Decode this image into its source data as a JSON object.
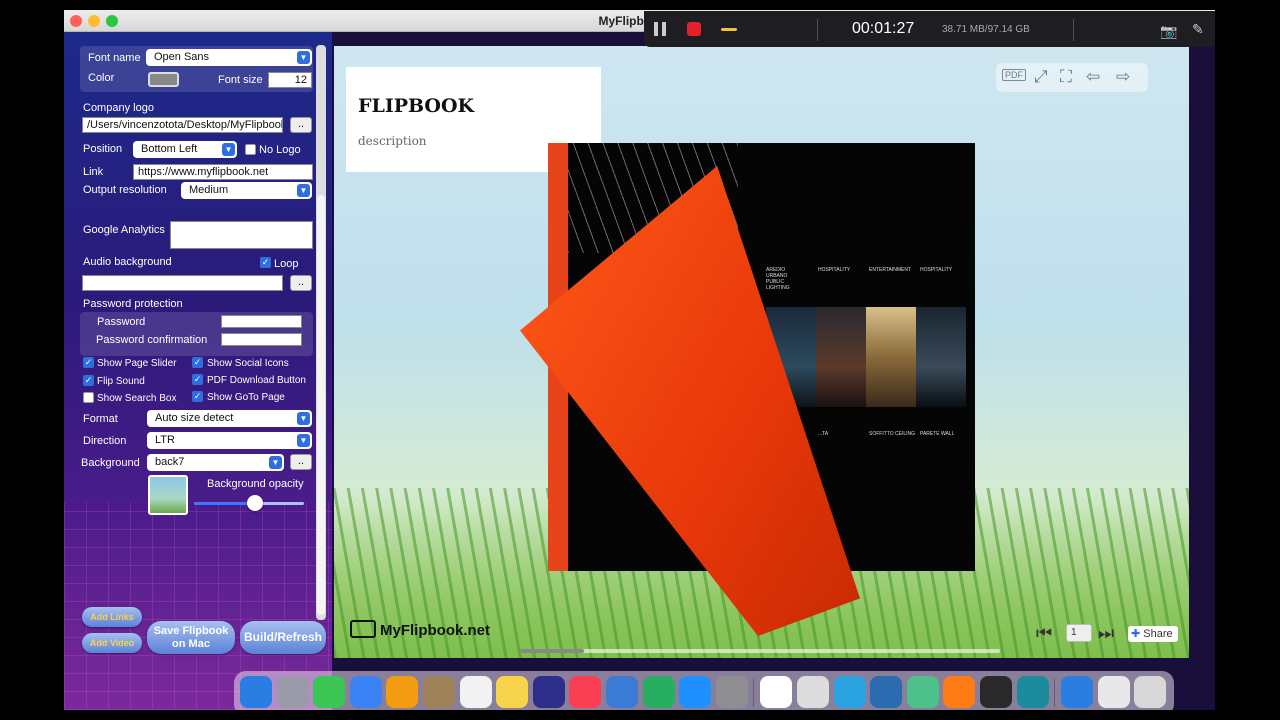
{
  "window": {
    "title": "MyFlipbook [P"
  },
  "recorder": {
    "time": "00:01:27",
    "size": "38.71 MB/97.14 GB"
  },
  "settings": {
    "font_name_label": "Font name",
    "font_name": "Open Sans",
    "color_label": "Color",
    "font_size_label": "Font size",
    "font_size": "12",
    "company_logo_label": "Company logo",
    "company_logo_path": "/Users/vincenzotota/Desktop/MyFlipbook",
    "browse": "..",
    "position_label": "Position",
    "position": "Bottom Left",
    "no_logo": "No Logo",
    "link_label": "Link",
    "link": "https://www.myflipbook.net",
    "output_resolution_label": "Output resolution",
    "output_resolution": "Medium",
    "google_analytics_label": "Google Analytics",
    "audio_background_label": "Audio background",
    "loop": "Loop",
    "password_protection_label": "Password protection",
    "password_label": "Password",
    "password_confirmation_label": "Password confirmation",
    "show_page_slider": "Show Page Slider",
    "show_social_icons": "Show Social Icons",
    "flip_sound": "Flip Sound",
    "pdf_download_button": "PDF Download Button",
    "show_search_box": "Show Search Box",
    "show_goto_page": "Show GoTo Page",
    "format_label": "Format",
    "format": "Auto size detect",
    "direction_label": "Direction",
    "direction": "LTR",
    "background_label": "Background",
    "background": "back7",
    "background_opacity_label": "Background opacity",
    "background_opacity": 0.55,
    "add_links": "Add Links",
    "add_video": "Add Video",
    "save_flipbook_line1": "Save Flipbook",
    "save_flipbook_line2": "on Mac",
    "build_refresh": "Build/Refresh"
  },
  "preview": {
    "title": "FLIPBOOK",
    "description": "description",
    "pdf_label": "PDF",
    "logo_text": "MyFlipbook.net",
    "page_number": "1",
    "share": "Share",
    "book_categories": [
      "AREDIO URBANO\nPUBLIC LIGHTING",
      "HOSPITALITY",
      "ENTERTAINMENT",
      "HOSPITALITY"
    ],
    "book_captions": [
      "...TA",
      "SOFFITTO\nCEILING",
      "PARETE\nWALL"
    ]
  },
  "dock_icons": [
    "finder-icon",
    "launchpad-icon",
    "messages-icon",
    "maps-icon",
    "photos-icon",
    "contacts-icon",
    "reminders-icon",
    "notes-icon",
    "freeform-icon",
    "music-icon",
    "keynote-icon",
    "numbers-icon",
    "app-store-icon",
    "system-settings-icon",
    "chrome-icon",
    "printer-icon",
    "telegram-icon",
    "xcode-icon",
    "atom-icon",
    "firefox-icon",
    "screen-recorder-icon",
    "myflipbook-icon",
    "downloads-icon",
    "preview-icon",
    "trash-icon"
  ],
  "colors": {
    "accent": "#2f6ee0",
    "flap": "#e8441a",
    "record": "#e4202b"
  }
}
